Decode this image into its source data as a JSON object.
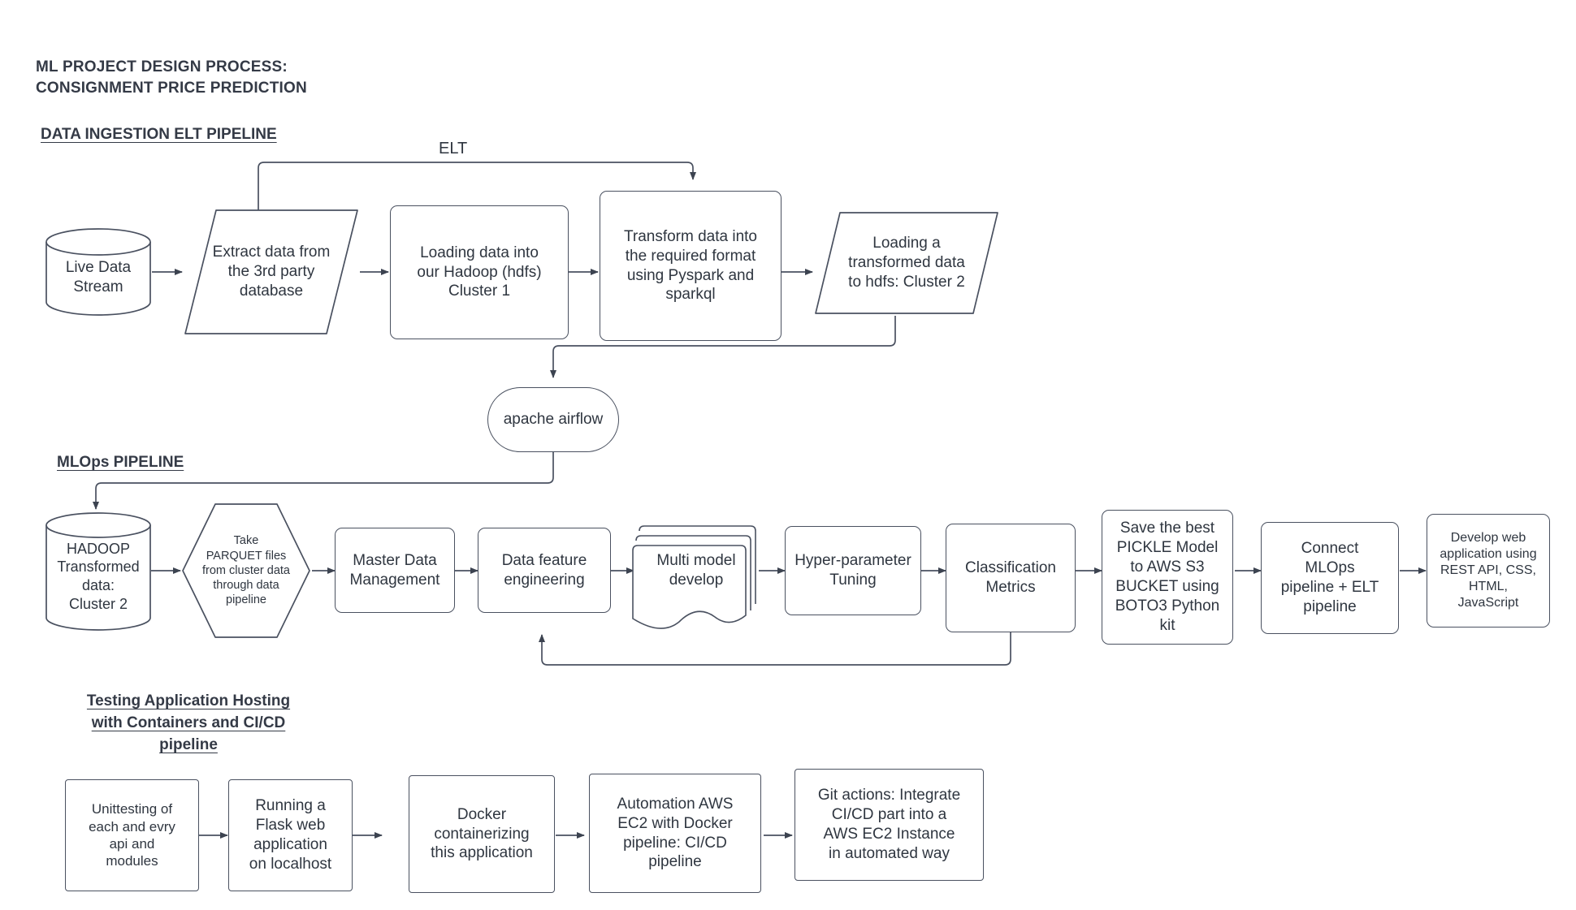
{
  "diagram": {
    "title": "ML PROJECT DESIGN PROCESS:\nCONSIGNMENT PRICE PREDICTION",
    "stroke_color": "#4a5160",
    "text_color": "#2f3640"
  },
  "sections": {
    "ingestion": {
      "heading": "DATA INGESTION ELT PIPELINE",
      "edge_label": "ELT",
      "nodes": [
        {
          "id": "live-data-stream",
          "label": "Live Data\nStream",
          "shape": "cylinder"
        },
        {
          "id": "extract-3rd-party",
          "label": "Extract data from\nthe 3rd party\ndatabase",
          "shape": "parallelogram"
        },
        {
          "id": "load-hadoop-cluster1",
          "label": "Loading data into\nour Hadoop (hdfs)\nCluster 1",
          "shape": "rect"
        },
        {
          "id": "transform-pyspark",
          "label": "Transform data into\nthe required format\nusing Pyspark and\nsparkql",
          "shape": "rect"
        },
        {
          "id": "load-hdfs-cluster2",
          "label": "Loading a\ntransformed data\nto hdfs: Cluster 2",
          "shape": "parallelogram"
        }
      ]
    },
    "orchestrator": {
      "nodes": [
        {
          "id": "apache-airflow",
          "label": "apache airflow",
          "shape": "stadium"
        }
      ]
    },
    "mlops": {
      "heading": "MLOps PIPELINE",
      "nodes": [
        {
          "id": "hadoop-transformed-cluster2",
          "label": "HADOOP\nTransformed\ndata:\nCluster 2",
          "shape": "cylinder"
        },
        {
          "id": "take-parquet-files",
          "label": "Take\nPARQUET files\nfrom cluster data\nthrough data\npipeline",
          "shape": "hexagon"
        },
        {
          "id": "master-data-management",
          "label": "Master Data\nManagement",
          "shape": "rect"
        },
        {
          "id": "data-feature-engineering",
          "label": "Data feature\nengineering",
          "shape": "rect"
        },
        {
          "id": "multi-model-develop",
          "label": "Multi model\ndevelop",
          "shape": "multi-document"
        },
        {
          "id": "hyper-parameter-tuning",
          "label": "Hyper-parameter\nTuning",
          "shape": "rect"
        },
        {
          "id": "classification-metrics",
          "label": "Classification\nMetrics",
          "shape": "rect"
        },
        {
          "id": "save-pickle-model-s3",
          "label": "Save the best\nPICKLE Model\nto AWS S3\nBUCKET using\nBOTO3 Python\nkit",
          "shape": "rect"
        },
        {
          "id": "connect-mlops-elt",
          "label": "Connect\nMLOps\npipeline + ELT\npipeline",
          "shape": "rect"
        },
        {
          "id": "develop-web-application",
          "label": "Develop web\napplication using\nREST API, CSS,\nHTML,\nJavaScript",
          "shape": "rect"
        }
      ]
    },
    "testing": {
      "heading": "Testing Application Hosting\nwith Containers and CI/CD\npipeline",
      "nodes": [
        {
          "id": "unittesting-apis",
          "label": "Unittesting of\neach and evry\napi and\nmodules",
          "shape": "rect"
        },
        {
          "id": "flask-localhost",
          "label": "Running a\nFlask web\napplication\non localhost",
          "shape": "rect"
        },
        {
          "id": "docker-containerizing",
          "label": "Docker\ncontainerizing\nthis application",
          "shape": "rect"
        },
        {
          "id": "aws-ec2-docker-cicd",
          "label": "Automation AWS\nEC2 with Docker\npipeline: CI/CD\npipeline",
          "shape": "rect"
        },
        {
          "id": "git-actions-cicd",
          "label": "Git actions: Integrate\nCI/CD part into a\nAWS EC2 Instance\nin automated way",
          "shape": "rect"
        }
      ]
    }
  }
}
